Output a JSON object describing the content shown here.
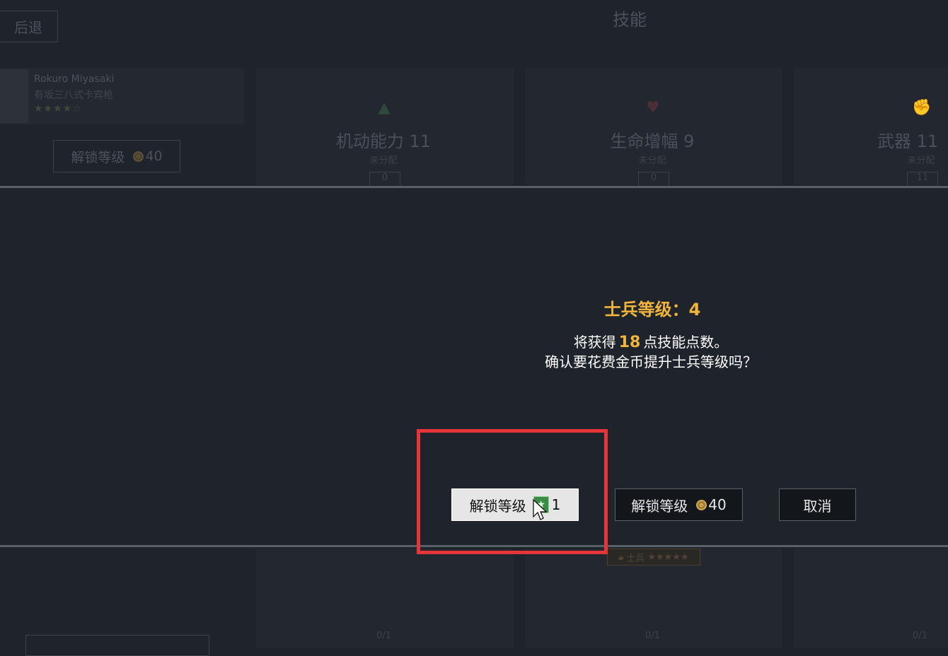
{
  "header": {
    "back_label": "后退",
    "title": "技能"
  },
  "soldier": {
    "name": "Rokuro Miyasaki",
    "weapon": "有坂三八式卡宾枪",
    "stars": "★★★★☆"
  },
  "bg_unlock": {
    "label": "解锁等级",
    "cost": "40"
  },
  "skills": [
    {
      "name": "机动能力 11",
      "status": "未分配",
      "value": "0"
    },
    {
      "name": "生命增幅 9",
      "status": "未分配",
      "value": "0"
    },
    {
      "name": "武器 11",
      "status": "未分配",
      "value": "11"
    }
  ],
  "lock_badge": {
    "label": "士兵",
    "stars": "★★★★★"
  },
  "bottom_fractions": [
    "0/1",
    "0/1",
    "0/1"
  ],
  "dialog": {
    "title": "士兵等级：4",
    "line1_pre": "将获得",
    "line1_num": "18",
    "line1_post": "点技能点数。",
    "line2": "确认要花费金币提升士兵等级吗？"
  },
  "buttons": {
    "token_label": "解锁等级",
    "token_cost": "1",
    "gold_label": "解锁等级",
    "gold_cost": "40",
    "cancel_label": "取消"
  },
  "colors": {
    "accent": "#f2b53b",
    "highlight": "#e53538",
    "background": "#1f232b"
  }
}
